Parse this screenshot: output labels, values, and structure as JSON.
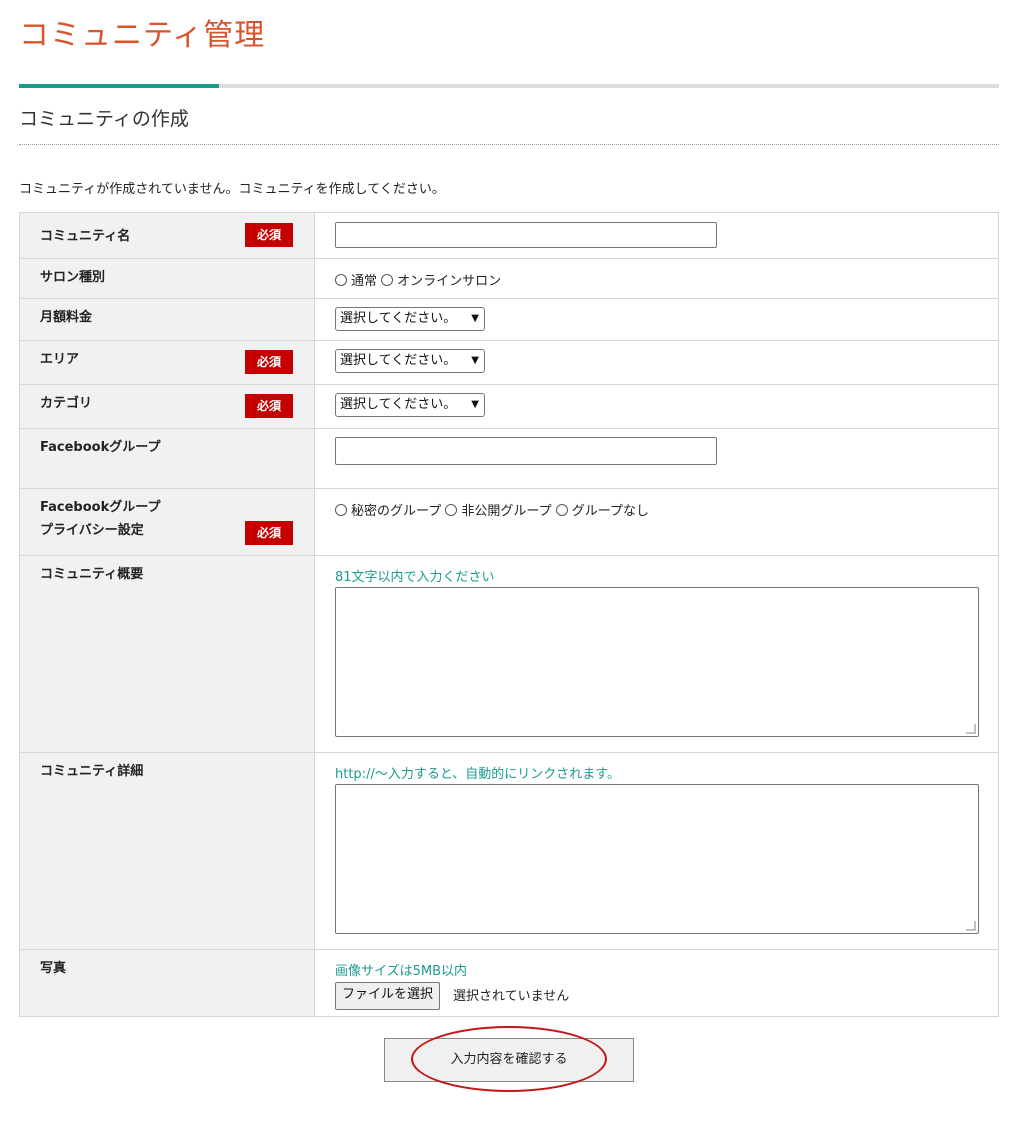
{
  "page_title": "コミュニティ管理",
  "section_title": "コミュニティの作成",
  "notice": "コミュニティが作成されていません。コミュニティを作成してください。",
  "required_badge": "必須",
  "colors": {
    "title": "#d9542c",
    "accent": "#1a9b8e",
    "required": "#c40000",
    "annotation": "#c41717"
  },
  "form": {
    "community_name": {
      "label": "コミュニティ名",
      "value": ""
    },
    "salon_type": {
      "label": "サロン種別",
      "options": [
        "通常",
        "オンラインサロン"
      ]
    },
    "monthly_fee": {
      "label": "月額料金",
      "selected": "選択してください。"
    },
    "area": {
      "label": "エリア",
      "selected": "選択してください。"
    },
    "category": {
      "label": "カテゴリ",
      "selected": "選択してください。"
    },
    "facebook_group": {
      "label": "Facebookグループ",
      "value": ""
    },
    "fb_privacy": {
      "label_line1": "Facebookグループ",
      "label_line2": "プライバシー設定",
      "options": [
        "秘密のグループ",
        "非公開グループ",
        "グループなし"
      ]
    },
    "summary": {
      "label": "コミュニティ概要",
      "hint": "81文字以内で入力ください",
      "value": ""
    },
    "detail": {
      "label": "コミュニティ詳細",
      "hint": "http://～入力すると、自動的にリンクされます。",
      "value": ""
    },
    "photo": {
      "label": "写真",
      "hint": "画像サイズは5MB以内",
      "file_button": "ファイルを選択",
      "file_status": "選択されていません"
    }
  },
  "confirm_button": "入力内容を確認する"
}
